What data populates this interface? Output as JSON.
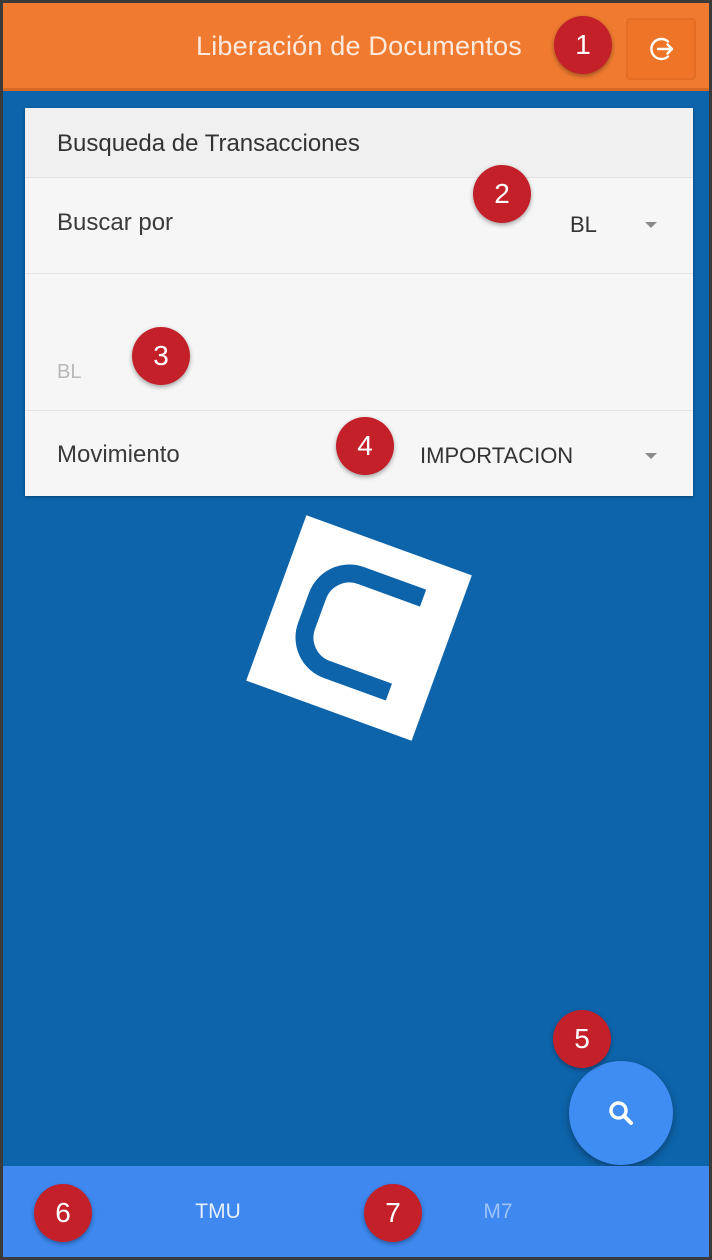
{
  "colors": {
    "header_bg": "#f07b30",
    "body_bg": "#0d64ab",
    "card_bg": "#f6f6f6",
    "fab_bg": "#3f8cf2",
    "tabbar_bg": "#3e88f0",
    "marker_bg": "#c3202a"
  },
  "header": {
    "title": "Liberación de Documentos",
    "logout_icon": "logout-icon"
  },
  "search_card": {
    "title": "Busqueda de Transacciones",
    "search_by": {
      "label": "Buscar por",
      "value": "BL"
    },
    "query_input": {
      "placeholder": "BL",
      "value": ""
    },
    "movement": {
      "label": "Movimiento",
      "value": "IMPORTACION"
    }
  },
  "logo": {
    "icon": "company-logo"
  },
  "fab": {
    "icon": "search-icon"
  },
  "tabs": [
    {
      "label": "TMU",
      "active": true
    },
    {
      "label": "M7",
      "active": false
    }
  ],
  "markers": [
    "1",
    "2",
    "3",
    "4",
    "5",
    "6",
    "7"
  ]
}
